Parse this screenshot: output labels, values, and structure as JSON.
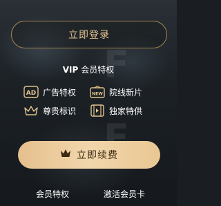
{
  "login": {
    "label": "立即登录"
  },
  "vip": {
    "prefix": "VIP",
    "title": "会员特权"
  },
  "perks": [
    {
      "label": "广告特权",
      "icon": "ad-icon"
    },
    {
      "label": "院线新片",
      "icon": "new-icon"
    },
    {
      "label": "尊贵标识",
      "icon": "crown-icon"
    },
    {
      "label": "独家特供",
      "icon": "film-icon"
    }
  ],
  "renew": {
    "label": "立即续费",
    "icon": "crown-icon"
  },
  "bottom_links": [
    {
      "label": "会员特权"
    },
    {
      "label": "激活会员卡"
    }
  ],
  "colors": {
    "gold": "#e2c38d",
    "gold_border": "#a8874e",
    "renew_bg": "#f1d6ac"
  }
}
